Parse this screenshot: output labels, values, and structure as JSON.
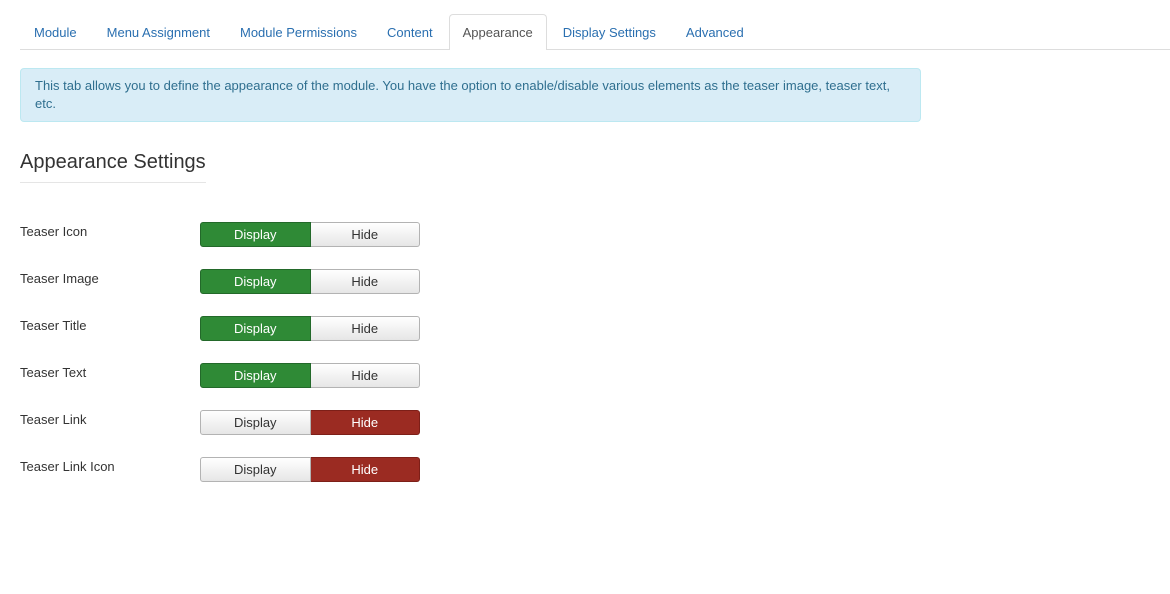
{
  "tabs": [
    {
      "label": "Module",
      "active": false
    },
    {
      "label": "Menu Assignment",
      "active": false
    },
    {
      "label": "Module Permissions",
      "active": false
    },
    {
      "label": "Content",
      "active": false
    },
    {
      "label": "Appearance",
      "active": true
    },
    {
      "label": "Display Settings",
      "active": false
    },
    {
      "label": "Advanced",
      "active": false
    }
  ],
  "alert": {
    "text": "This tab allows you to define the appearance of the module. You have the option to enable/disable various elements as the teaser image, teaser text, etc."
  },
  "section": {
    "title": "Appearance Settings"
  },
  "options": {
    "display_label": "Display",
    "hide_label": "Hide"
  },
  "settings": [
    {
      "label": "Teaser Icon",
      "value": "Display"
    },
    {
      "label": "Teaser Image",
      "value": "Display"
    },
    {
      "label": "Teaser Title",
      "value": "Display"
    },
    {
      "label": "Teaser Text",
      "value": "Display"
    },
    {
      "label": "Teaser Link",
      "value": "Hide"
    },
    {
      "label": "Teaser Link Icon",
      "value": "Hide"
    }
  ],
  "colors": {
    "display_active": "#2f8a36",
    "hide_active": "#9b2b22",
    "tab_link": "#2a6fb0",
    "alert_bg": "#d9edf7"
  }
}
